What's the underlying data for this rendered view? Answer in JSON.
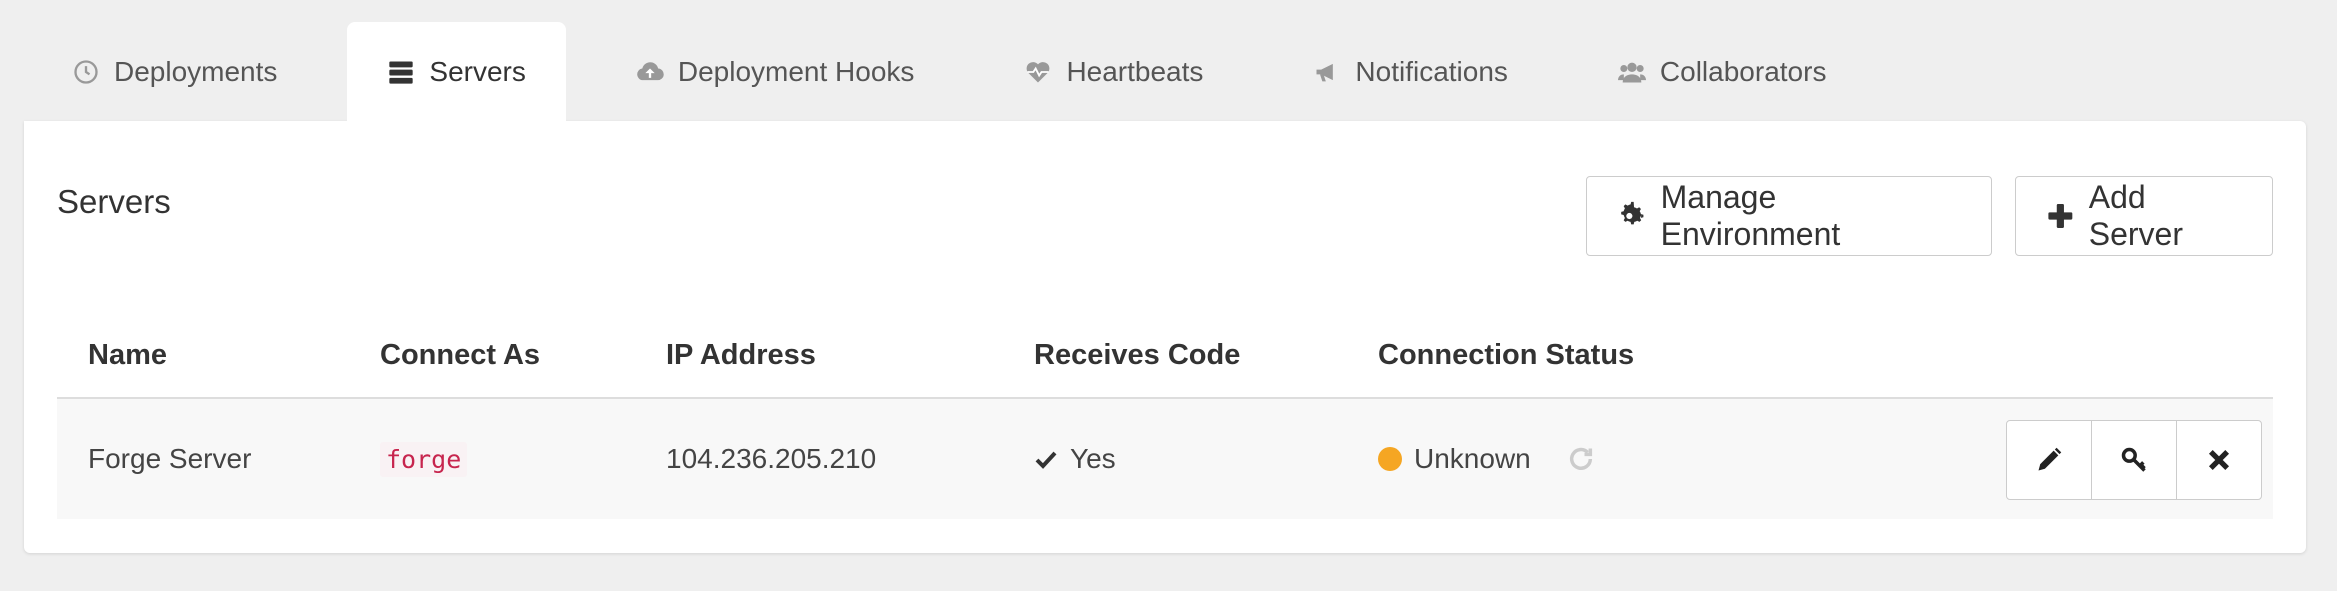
{
  "tabs": [
    {
      "label": "Deployments",
      "icon": "clock-icon",
      "active": false
    },
    {
      "label": "Servers",
      "icon": "server-icon",
      "active": true
    },
    {
      "label": "Deployment Hooks",
      "icon": "cloud-upload-icon",
      "active": false
    },
    {
      "label": "Heartbeats",
      "icon": "heartbeat-icon",
      "active": false
    },
    {
      "label": "Notifications",
      "icon": "megaphone-icon",
      "active": false
    },
    {
      "label": "Collaborators",
      "icon": "users-icon",
      "active": false
    }
  ],
  "panel": {
    "title": "Servers",
    "manage_label": "Manage Environment",
    "add_label": "Add Server"
  },
  "table": {
    "headers": [
      "Name",
      "Connect As",
      "IP Address",
      "Receives Code",
      "Connection Status"
    ],
    "rows": [
      {
        "name": "Forge Server",
        "connect_as": "forge",
        "ip": "104.236.205.210",
        "receives_code": "Yes",
        "status": "Unknown",
        "status_color": "#f5a623"
      }
    ]
  },
  "colors": {
    "code_text": "#c7254e",
    "status_unknown": "#f5a623"
  }
}
